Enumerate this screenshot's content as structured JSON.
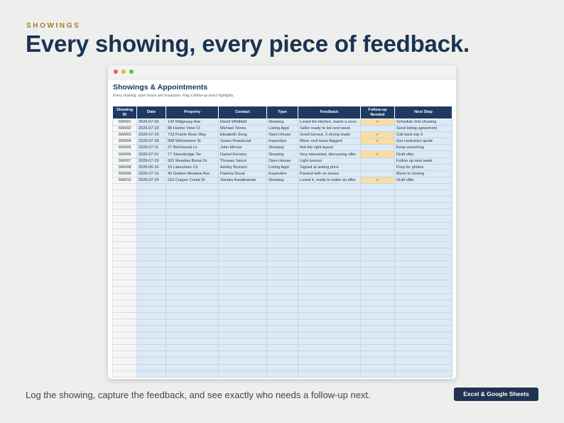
{
  "kicker": "SHOWINGS",
  "headline": "Every showing, every piece of feedback.",
  "sheet": {
    "title": "Showings & Appointments",
    "subtitle": "Every showing, open house and inspection. Flag a follow-up and it highlights.",
    "columns": [
      "Showing ID",
      "Date",
      "Property",
      "Contact",
      "Type",
      "Feedback",
      "Follow-up Needed",
      "Next Step"
    ],
    "rows": [
      {
        "id": "SW001",
        "date": "2026-07-26",
        "property": "142 Ridgeway Ave",
        "contact": "David Whitfield",
        "type": "Showing",
        "feedback": "Loved the kitchen, wants a seco",
        "followup": "✓",
        "next": "Schedule 2nd showing"
      },
      {
        "id": "SW002",
        "date": "2026-07-23",
        "property": "88 Harbor View Ct",
        "contact": "Michael Torres",
        "type": "Listing Appt",
        "feedback": "Seller ready to list next week",
        "followup": "",
        "next": "Send listing agreement"
      },
      {
        "id": "SW003",
        "date": "2026-07-19",
        "property": "733 Prairie Rose Way",
        "contact": "Elizabeth Song",
        "type": "Open House",
        "feedback": "Good turnout, 3 strong leads",
        "followup": "✓",
        "next": "Call back top 3"
      },
      {
        "id": "SW004",
        "date": "2026-07-28",
        "property": "908 Willowmere St",
        "contact": "Susan Kowalczyk",
        "type": "Inspection",
        "feedback": "Minor roof issue flagged",
        "followup": "✓",
        "next": "Get contractor quote"
      },
      {
        "id": "SW005",
        "date": "2026-07-11",
        "property": "27 Birchwood Ln",
        "contact": "John Mercer",
        "type": "Showing",
        "feedback": "Not the right layout",
        "followup": "",
        "next": "Keep searching"
      },
      {
        "id": "SW006",
        "date": "2026-07-01",
        "property": "77 Stonebridge Ter",
        "contact": "Daniel Ferreira",
        "type": "Showing",
        "feedback": "Very interested, discussing offer",
        "followup": "✓",
        "next": "Draft offer"
      },
      {
        "id": "SW007",
        "date": "2026-07-29",
        "property": "501 Meadow Brook Dr",
        "contact": "Thomas Vance",
        "type": "Open House",
        "feedback": "Light turnout",
        "followup": "",
        "next": "Follow up next week"
      },
      {
        "id": "SW008",
        "date": "2026-06-16",
        "property": "19 Lakeshore Cir",
        "contact": "Ashley Romero",
        "type": "Listing Appt",
        "feedback": "Signed at asking price",
        "followup": "",
        "next": "Prep for photos"
      },
      {
        "id": "SW009",
        "date": "2026-07-16",
        "property": "45 Golden Meadow Ave",
        "contact": "Patricia Duval",
        "type": "Inspection",
        "feedback": "Passed with no issues",
        "followup": "",
        "next": "Move to closing"
      },
      {
        "id": "SW010",
        "date": "2026-07-24",
        "property": "210 Copper Creek Dr",
        "contact": "Sandra Kwiatkowski",
        "type": "Showing",
        "feedback": "Loved it, ready to make an offer",
        "followup": "✓",
        "next": "Draft offer"
      }
    ]
  },
  "caption": "Log the showing, capture the feedback, and see exactly who needs a follow-up next.",
  "badge": "Excel & Google Sheets",
  "colors": {
    "header_fill": "#1e3a61",
    "data_fill": "#dce9f6",
    "followup_highlight": "#f9dea2",
    "kicker": "#a87a2e",
    "headline": "#1b3350"
  }
}
